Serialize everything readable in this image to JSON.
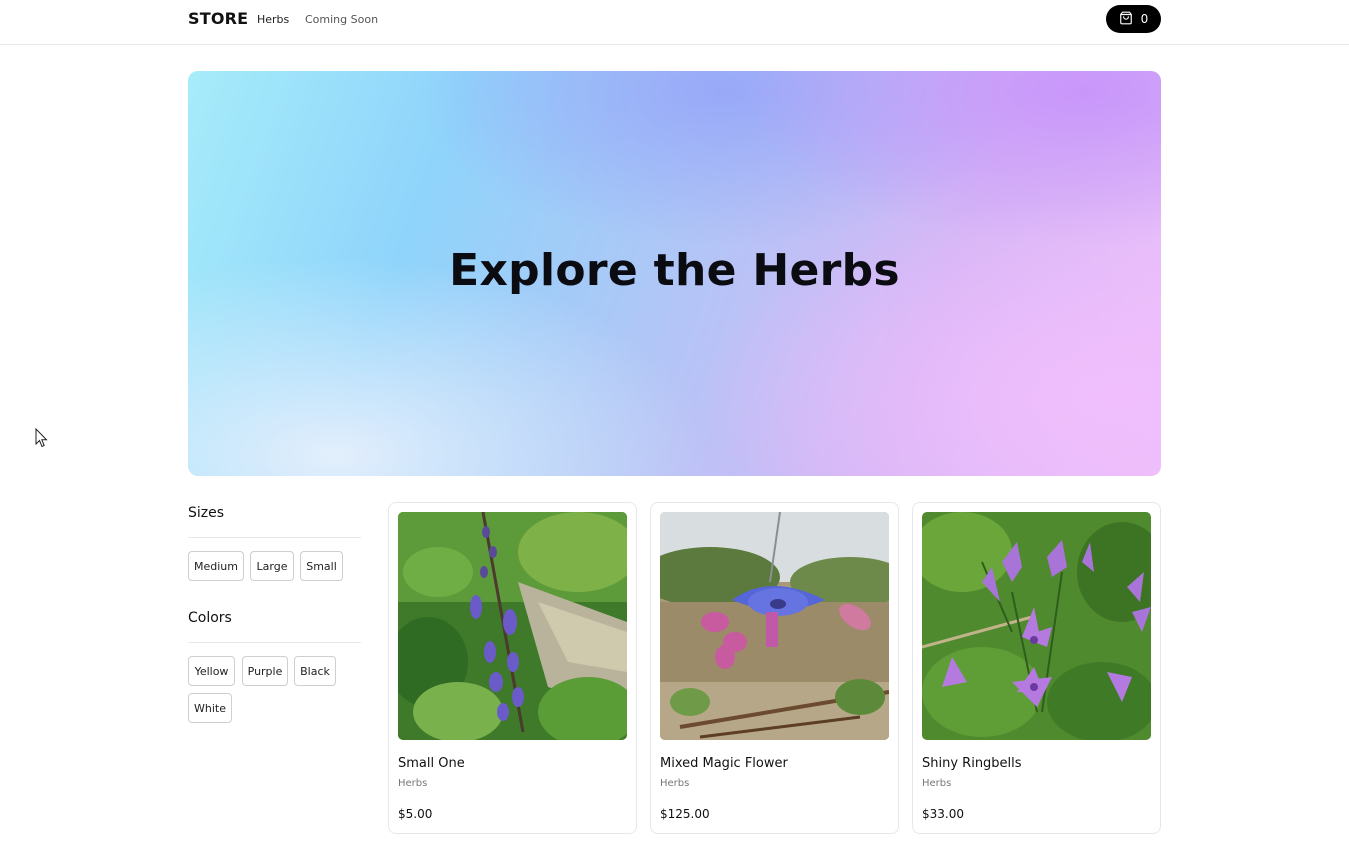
{
  "header": {
    "brand": "STORE",
    "nav": [
      "Herbs",
      "Coming Soon"
    ],
    "cart_count": "0"
  },
  "hero": {
    "title": "Explore the Herbs"
  },
  "filters": {
    "sizes_title": "Sizes",
    "sizes": [
      "Medium",
      "Large",
      "Small"
    ],
    "colors_title": "Colors",
    "colors": [
      "Yellow",
      "Purple",
      "Black",
      "White"
    ]
  },
  "products": [
    {
      "name": "Small One",
      "category": "Herbs",
      "price": "$5.00"
    },
    {
      "name": "Mixed Magic Flower",
      "category": "Herbs",
      "price": "$125.00"
    },
    {
      "name": "Shiny Ringbells",
      "category": "Herbs",
      "price": "$33.00"
    }
  ],
  "colors": {
    "cart_bg": "#000000",
    "text": "#111111",
    "muted": "#777777",
    "border": "#e5e7eb"
  },
  "icons": {
    "cart": "shopping-bag-icon",
    "cursor": "mouse-pointer-icon"
  }
}
